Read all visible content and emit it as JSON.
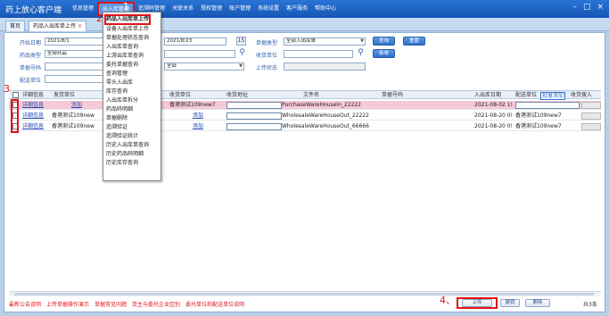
{
  "app": {
    "title": "药上放心客户端",
    "window_controls": [
      "–",
      "□",
      "×"
    ]
  },
  "menubar": [
    {
      "label": "信息管理",
      "active": false
    },
    {
      "label": "出入库管理",
      "active": true
    },
    {
      "label": "追溯码管理",
      "active": false
    },
    {
      "label": "关联关系",
      "active": false
    },
    {
      "label": "授权管理",
      "active": false
    },
    {
      "label": "账户管理",
      "active": false
    },
    {
      "label": "系统设置",
      "active": false
    },
    {
      "label": "客户服务",
      "active": false
    },
    {
      "label": "帮助中心",
      "active": false
    }
  ],
  "tabs": {
    "home": "首页",
    "current": "药品入出库单上传",
    "close": "×"
  },
  "form": {
    "start_date_label": "开始日期",
    "start_date": "2021/8/1",
    "end_date": "2021/8/23",
    "calendar_icon": "15",
    "bill_type_label": "单据类型",
    "bill_type": "全部入出库单",
    "query_btn": "查询",
    "reset_btn": "重置",
    "drug_type_label": "药品类型",
    "drug_type": "全部药品",
    "recv_unit_label": "收货单位",
    "recv_unit": "",
    "split_btn": "拆单",
    "bill_no_label": "单据号码",
    "bill_no": "",
    "entrust_value": "全部",
    "upload_status_label": "上传状态",
    "dist_unit_label": "配送单位"
  },
  "grid": {
    "headers": [
      "详细信息",
      "发货单位",
      "收货单位",
      "收货地址",
      "文件名",
      "单据号码",
      "入出库日期",
      "配送单位",
      "批量添加",
      "收货拨入"
    ],
    "rows": [
      {
        "detail": "详细信息",
        "ship_unit": "添加",
        "recv_unit": "香港测试109new7",
        "file_name": "PurchaseWareHouseIn_22222",
        "bill_no": "",
        "date": "2021-08-02 1!",
        "dist_unit": "",
        "highlight": true
      },
      {
        "detail": "详细信息",
        "ship_unit": "香港测试109new",
        "recv_unit": "添加",
        "file_name": "WholesaleWareHouseOut_22222",
        "bill_no": "",
        "date": "2021-08-20 0!",
        "dist_unit": "香港测试109new7",
        "highlight": false
      },
      {
        "detail": "详细信息",
        "ship_unit": "香港测试109new",
        "recv_unit": "添加",
        "file_name": "WholesaleWareHouseOut_66666",
        "bill_no": "",
        "date": "2021-08-20 0!",
        "dist_unit": "香港测试109new7",
        "highlight": false
      }
    ]
  },
  "dropdown": {
    "items": [
      "药品入出库单上传",
      "设备入出库单上传",
      "单据处理状态查询",
      "入出库单查询",
      "上游出库单查询",
      "委托单据查询",
      "查询管理",
      "零头入出库",
      "库存查询",
      "入出库单拆分",
      "药品码明细",
      "单据删除",
      "追溯验证",
      "追溯验证统计",
      "历史入出库单查询",
      "历史药品码明细",
      "历史库存查询"
    ]
  },
  "annotations": [
    "1",
    "2",
    "3",
    "4、"
  ],
  "footer": {
    "links": [
      "最新公告说明",
      "上传单据操作演示",
      "单据常见问题",
      "货主与委托企业区别",
      "委托单位和配送单位说明"
    ],
    "buttons": [
      "上传",
      "撤销",
      "删除"
    ],
    "total": "共3条"
  },
  "colors": {
    "titlebar": "#1f66c8",
    "accent_red": "#e0141a",
    "highlight_row": "#f6c9d7",
    "link": "#2348b8"
  }
}
